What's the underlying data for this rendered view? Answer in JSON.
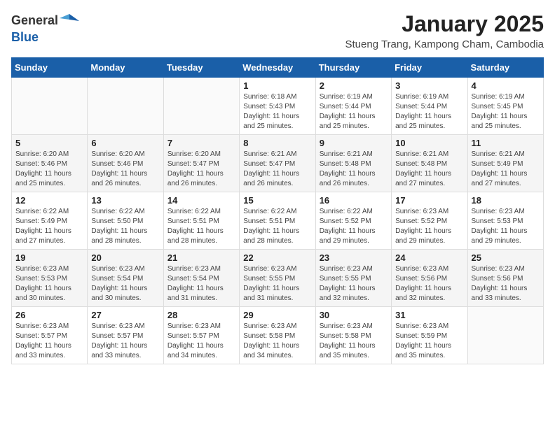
{
  "header": {
    "logo_line1": "General",
    "logo_line2": "Blue",
    "month_title": "January 2025",
    "location": "Stueng Trang, Kampong Cham, Cambodia"
  },
  "weekdays": [
    "Sunday",
    "Monday",
    "Tuesday",
    "Wednesday",
    "Thursday",
    "Friday",
    "Saturday"
  ],
  "weeks": [
    [
      {
        "day": "",
        "info": ""
      },
      {
        "day": "",
        "info": ""
      },
      {
        "day": "",
        "info": ""
      },
      {
        "day": "1",
        "info": "Sunrise: 6:18 AM\nSunset: 5:43 PM\nDaylight: 11 hours\nand 25 minutes."
      },
      {
        "day": "2",
        "info": "Sunrise: 6:19 AM\nSunset: 5:44 PM\nDaylight: 11 hours\nand 25 minutes."
      },
      {
        "day": "3",
        "info": "Sunrise: 6:19 AM\nSunset: 5:44 PM\nDaylight: 11 hours\nand 25 minutes."
      },
      {
        "day": "4",
        "info": "Sunrise: 6:19 AM\nSunset: 5:45 PM\nDaylight: 11 hours\nand 25 minutes."
      }
    ],
    [
      {
        "day": "5",
        "info": "Sunrise: 6:20 AM\nSunset: 5:46 PM\nDaylight: 11 hours\nand 25 minutes."
      },
      {
        "day": "6",
        "info": "Sunrise: 6:20 AM\nSunset: 5:46 PM\nDaylight: 11 hours\nand 26 minutes."
      },
      {
        "day": "7",
        "info": "Sunrise: 6:20 AM\nSunset: 5:47 PM\nDaylight: 11 hours\nand 26 minutes."
      },
      {
        "day": "8",
        "info": "Sunrise: 6:21 AM\nSunset: 5:47 PM\nDaylight: 11 hours\nand 26 minutes."
      },
      {
        "day": "9",
        "info": "Sunrise: 6:21 AM\nSunset: 5:48 PM\nDaylight: 11 hours\nand 26 minutes."
      },
      {
        "day": "10",
        "info": "Sunrise: 6:21 AM\nSunset: 5:48 PM\nDaylight: 11 hours\nand 27 minutes."
      },
      {
        "day": "11",
        "info": "Sunrise: 6:21 AM\nSunset: 5:49 PM\nDaylight: 11 hours\nand 27 minutes."
      }
    ],
    [
      {
        "day": "12",
        "info": "Sunrise: 6:22 AM\nSunset: 5:49 PM\nDaylight: 11 hours\nand 27 minutes."
      },
      {
        "day": "13",
        "info": "Sunrise: 6:22 AM\nSunset: 5:50 PM\nDaylight: 11 hours\nand 28 minutes."
      },
      {
        "day": "14",
        "info": "Sunrise: 6:22 AM\nSunset: 5:51 PM\nDaylight: 11 hours\nand 28 minutes."
      },
      {
        "day": "15",
        "info": "Sunrise: 6:22 AM\nSunset: 5:51 PM\nDaylight: 11 hours\nand 28 minutes."
      },
      {
        "day": "16",
        "info": "Sunrise: 6:22 AM\nSunset: 5:52 PM\nDaylight: 11 hours\nand 29 minutes."
      },
      {
        "day": "17",
        "info": "Sunrise: 6:23 AM\nSunset: 5:52 PM\nDaylight: 11 hours\nand 29 minutes."
      },
      {
        "day": "18",
        "info": "Sunrise: 6:23 AM\nSunset: 5:53 PM\nDaylight: 11 hours\nand 29 minutes."
      }
    ],
    [
      {
        "day": "19",
        "info": "Sunrise: 6:23 AM\nSunset: 5:53 PM\nDaylight: 11 hours\nand 30 minutes."
      },
      {
        "day": "20",
        "info": "Sunrise: 6:23 AM\nSunset: 5:54 PM\nDaylight: 11 hours\nand 30 minutes."
      },
      {
        "day": "21",
        "info": "Sunrise: 6:23 AM\nSunset: 5:54 PM\nDaylight: 11 hours\nand 31 minutes."
      },
      {
        "day": "22",
        "info": "Sunrise: 6:23 AM\nSunset: 5:55 PM\nDaylight: 11 hours\nand 31 minutes."
      },
      {
        "day": "23",
        "info": "Sunrise: 6:23 AM\nSunset: 5:55 PM\nDaylight: 11 hours\nand 32 minutes."
      },
      {
        "day": "24",
        "info": "Sunrise: 6:23 AM\nSunset: 5:56 PM\nDaylight: 11 hours\nand 32 minutes."
      },
      {
        "day": "25",
        "info": "Sunrise: 6:23 AM\nSunset: 5:56 PM\nDaylight: 11 hours\nand 33 minutes."
      }
    ],
    [
      {
        "day": "26",
        "info": "Sunrise: 6:23 AM\nSunset: 5:57 PM\nDaylight: 11 hours\nand 33 minutes."
      },
      {
        "day": "27",
        "info": "Sunrise: 6:23 AM\nSunset: 5:57 PM\nDaylight: 11 hours\nand 33 minutes."
      },
      {
        "day": "28",
        "info": "Sunrise: 6:23 AM\nSunset: 5:57 PM\nDaylight: 11 hours\nand 34 minutes."
      },
      {
        "day": "29",
        "info": "Sunrise: 6:23 AM\nSunset: 5:58 PM\nDaylight: 11 hours\nand 34 minutes."
      },
      {
        "day": "30",
        "info": "Sunrise: 6:23 AM\nSunset: 5:58 PM\nDaylight: 11 hours\nand 35 minutes."
      },
      {
        "day": "31",
        "info": "Sunrise: 6:23 AM\nSunset: 5:59 PM\nDaylight: 11 hours\nand 35 minutes."
      },
      {
        "day": "",
        "info": ""
      }
    ]
  ]
}
